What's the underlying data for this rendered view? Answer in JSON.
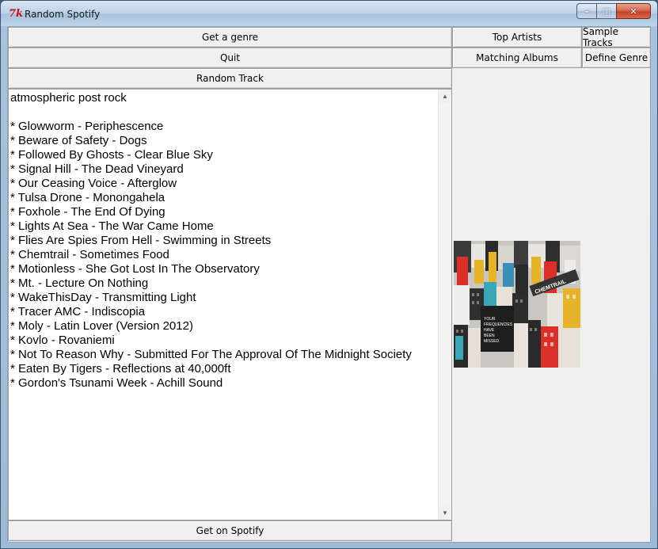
{
  "window": {
    "title": "Random Spotify",
    "controls": {
      "minimize": "–",
      "maximize": "□",
      "close": "✕"
    }
  },
  "buttons": {
    "get_genre": "Get a genre",
    "top_artists": "Top Artists",
    "sample_tracks": "Sample Tracks",
    "quit": "Quit",
    "matching_albums": "Matching Albums",
    "define_genre": "Define Genre",
    "random_track": "Random Track",
    "get_on_spotify": "Get on Spotify"
  },
  "output": {
    "genre": "atmospheric post rock",
    "tracks": [
      "* Glowworm - Periphescence",
      "* Beware of Safety - Dogs",
      "* Followed By Ghosts - Clear Blue Sky",
      "* Signal Hill - The Dead Vineyard",
      "* Our Ceasing Voice - Afterglow",
      "* Tulsa Drone - Monongahela",
      "* Foxhole - The End Of Dying",
      "* Lights At Sea - The War Came Home",
      "* Flies Are Spies From Hell - Swimming in Streets",
      "* Chemtrail - Sometimes Food",
      "* Motionless - She Got Lost In The Observatory",
      "* Mt. - Lecture On Nothing",
      "* WakeThisDay - Transmitting Light",
      "* Tracer AMC - Indiscopia",
      "* Moly - Latin Lover (Version 2012)",
      "* Kovlo - Rovaniemi",
      "* Not To Reason Why - Submitted For The Approval Of The Midnight Society",
      "* Eaten By Tigers - Reflections at 40,000ft",
      "* Gordon's Tsunami Week - Achill Sound"
    ]
  },
  "album_art": {
    "band": "CHEMTRAIL",
    "lines": [
      "YOUR",
      "FREQUENCIES",
      "HAVE",
      "BEEN",
      "MISSED."
    ]
  },
  "icons": {
    "app": "tk-feather-icon",
    "scroll_up": "▲",
    "scroll_down": "▼"
  }
}
